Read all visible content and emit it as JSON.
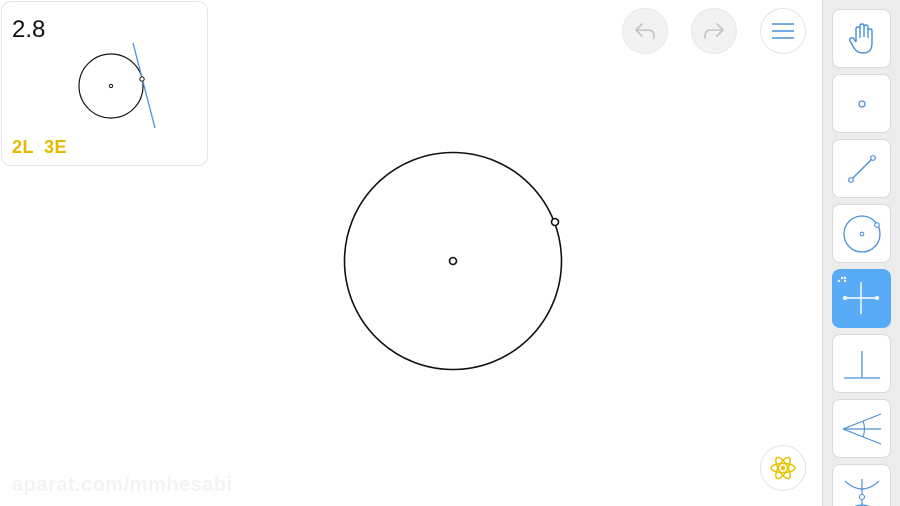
{
  "level": {
    "number": "2.8",
    "goal": {
      "lines": "2L",
      "elements": "3E"
    }
  },
  "toolbar": {
    "tools": [
      {
        "name": "hand",
        "label": "Move"
      },
      {
        "name": "point",
        "label": "Point"
      },
      {
        "name": "line",
        "label": "Line"
      },
      {
        "name": "circle",
        "label": "Circle"
      },
      {
        "name": "perpendicular-bisector",
        "label": "Perpendicular bisector",
        "active": true
      },
      {
        "name": "perpendicular",
        "label": "Perpendicular"
      },
      {
        "name": "angle-bisector",
        "label": "Angle bisector"
      },
      {
        "name": "intersect",
        "label": "Compass"
      }
    ]
  },
  "buttons": {
    "undo": "undo-icon",
    "redo": "redo-icon",
    "menu": "menu-icon",
    "hint": "hint-icon"
  },
  "watermark": "aparat.com/mmhesabi",
  "colors": {
    "accent": "#5aabf5",
    "tool_line": "#4a90d9",
    "goal": "#e6b800",
    "toolbar_bg": "#ececec",
    "hint_icon": "#e6c200"
  }
}
